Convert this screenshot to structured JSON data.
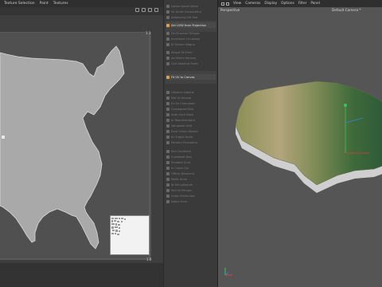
{
  "left_panel": {
    "menus": [
      "Texture Selection",
      "Paint",
      "Textures"
    ],
    "uv_labels": {
      "top_right": "1.1",
      "bottom_right": "1.0"
    }
  },
  "middle_panel": {
    "items": [
      "Lorem Ipsum Dolor",
      "Sit Amet Consectetur",
      "Adipiscing Elit Sed",
      "Set UVW from Projection",
      "Do Eiusmod Tempor",
      "Incididunt Ut Labore",
      "Et Dolore Magna",
      "Aliqua Ut Enim",
      "Ad Minim Veniam",
      "Quis Nostrud Exerc",
      "Fit UV to Canvas",
      "Ullamco Laboris",
      "Nisi Ut Aliquip",
      "Ex Ea Commodo",
      "Consequat Duis",
      "Aute Irure Dolor",
      "In Reprehenderit",
      "Voluptate Velit",
      "Esse Cillum Dolore",
      "Eu Fugiat Nulla",
      "Pariatur Excepteur",
      "Sint Occaecat",
      "Cupidatat Non",
      "Proident Sunt",
      "In Culpa Qui",
      "Officia Deserunt",
      "Mollit Anim",
      "Id Est Laborum",
      "Sed Ut Perspic",
      "Unde Omnis Iste",
      "Natus Error"
    ]
  },
  "right_panel": {
    "menus": [
      "View",
      "Cameras",
      "Display",
      "Options",
      "Filter",
      "Panel"
    ],
    "viewport_name": "Perspective",
    "camera_name": "Default Camera *"
  },
  "colors": {
    "active_icon": "#d9a441",
    "axis_x": "#e23b3b",
    "axis_y": "#3bc45a",
    "axis_z": "#3b7fe2"
  }
}
